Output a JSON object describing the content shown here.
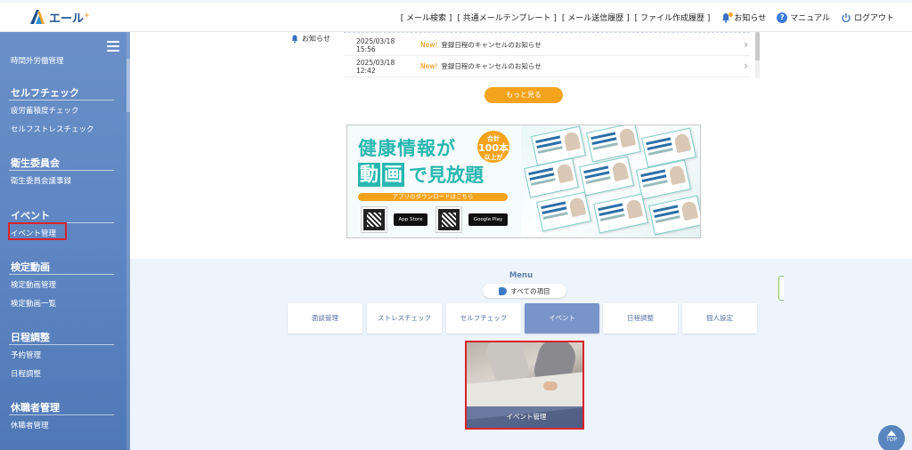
{
  "header": {
    "logo_text": "エール",
    "logo_plus": "+",
    "nav": [
      "[ メール検索 ]",
      "[ 共通メールテンプレート ]",
      "[ メール送信履歴 ]",
      "[ ファイル作成履歴 ]"
    ],
    "notifications_label": "お知らせ",
    "manual_label": "マニュアル",
    "logout_label": "ログアウト"
  },
  "sidebar": {
    "top_item": "時間外労働管理",
    "sections": [
      {
        "heading": "セルフチェック",
        "items": [
          "疲労蓄積度チェック",
          "セルフストレスチェック"
        ]
      },
      {
        "heading": "衛生委員会",
        "items": [
          "衛生委員会議事録"
        ]
      },
      {
        "heading": "イベント",
        "items": [
          "イベント管理"
        ]
      },
      {
        "heading": "検定動画",
        "items": [
          "検定動画管理",
          "検定動画一覧"
        ]
      },
      {
        "heading": "日程調整",
        "items": [
          "予約管理",
          "日程調整"
        ]
      },
      {
        "heading": "休職者管理",
        "items": [
          "休職者管理"
        ]
      }
    ]
  },
  "notices": {
    "label": "お知らせ",
    "items": [
      {
        "date": "2025/03/18 15:56",
        "tag": "New!",
        "title": "登録日程のキャンセルのお知らせ"
      },
      {
        "date": "2025/03/18 12:42",
        "tag": "New!",
        "title": "登録日程のキャンセルのお知らせ"
      }
    ],
    "more_label": "もっと見る"
  },
  "banner": {
    "line1": "健康情報が",
    "line2_box1": "動",
    "line2_box2": "画",
    "line2_rest": "で見放題",
    "badge_top": "合計",
    "badge_big": "100本",
    "badge_bottom": "以上が",
    "download": "アプリのダウンロードはこちら",
    "app_store": "App Store",
    "google_play": "Google Play"
  },
  "menu": {
    "title": "Menu",
    "all_items_label": "すべての項目",
    "buttons": [
      "面談管理",
      "ストレスチェック",
      "セルフチェック",
      "イベント",
      "日程調整",
      "個人設定"
    ],
    "active_index": 3,
    "tile_caption": "イベント管理"
  },
  "top_button": "TOP"
}
